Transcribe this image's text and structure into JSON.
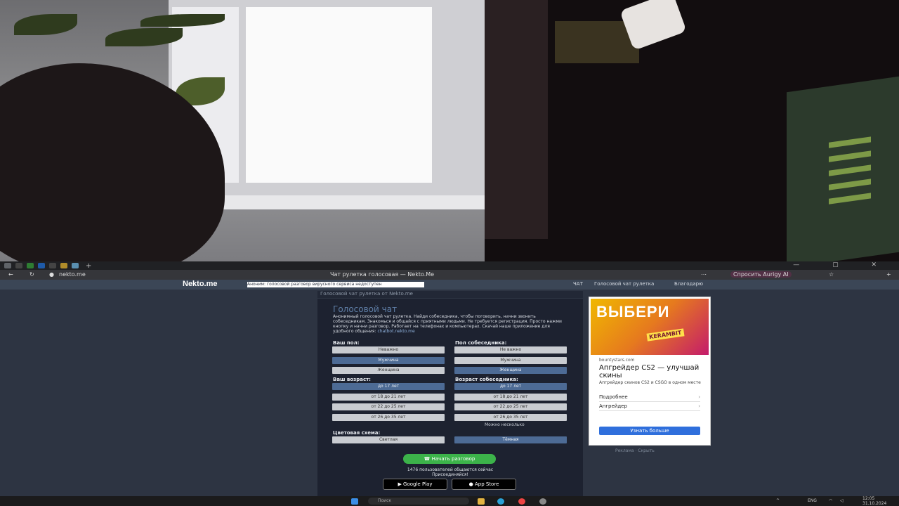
{
  "browser": {
    "url": "nekto.me",
    "tab_title": "Чат рулетка голосовая — Nekto.Me",
    "ai_button": "Спросить Aurigy AI",
    "window_controls": "— ▢ ✕"
  },
  "site": {
    "logo": "Nekto.me",
    "notice": "Аноним: голосовой разговор вирусного сервиса недоступен",
    "nav": [
      "ЧАТ",
      "Голосовой чат рулетка",
      "Благодарю"
    ],
    "breadcrumb": "Голосовой чат рулетка от Nekto.me"
  },
  "form": {
    "heading": "Голосовой чат",
    "description": "Анонимный голосовой чат рулетка. Найди собеседника, чтобы поговорить, начни звонить собеседникам. Знакомься и общайся с приятными людьми. Не требуется регистрация. Просто нажми кнопку и начни разговор. Работает на телефонах и компьютерах. Скачай наше приложение для удобного общения: ",
    "description_link": "chatbot.nekto.me",
    "your_gender_label": "Ваш пол:",
    "partner_gender_label": "Пол собеседника:",
    "your_gender_options": [
      "Неважно",
      "Мужчина",
      "Женщина"
    ],
    "partner_gender_options": [
      "Не важно",
      "Мужчина",
      "Женщина"
    ],
    "your_age_label": "Ваш возраст:",
    "partner_age_label": "Возраст собеседника:",
    "your_age_options": [
      "до 17 лет",
      "от 18 до 21 лет",
      "от 22 до 25 лет",
      "от 26 до 35 лет"
    ],
    "partner_age_options": [
      "до 17 лет",
      "от 18 до 21 лет",
      "от 22 до 25 лет",
      "от 26 до 35 лет"
    ],
    "multi_note": "Можно несколько",
    "theme_label": "Цветовая схема:",
    "theme_options": [
      "Светлая",
      "Тёмная"
    ],
    "start_button": "Начать разговор",
    "online_stat": "1476 пользователей общаются сейчас",
    "online_sub": "Присоединяйся!",
    "google_play": "Google Play",
    "app_store": "App Store"
  },
  "ad": {
    "headline_image": "ВЫБЕРИ",
    "image_tag": "KERAMBIT",
    "domain": "bountystars.com",
    "title": "Апгрейдер CS2 — улучшай скины",
    "subtitle": "Апгрейдер скинов CS2 и CSGO в одном месте",
    "links": [
      "Подробнее",
      "Апгрейдер"
    ],
    "cta": "Узнать больше",
    "footer": "Реклама · Скрыть"
  },
  "taskbar": {
    "search_placeholder": "Поиск",
    "tray_lang": "ENG",
    "clock": "12:05",
    "date": "31.10.2024"
  }
}
